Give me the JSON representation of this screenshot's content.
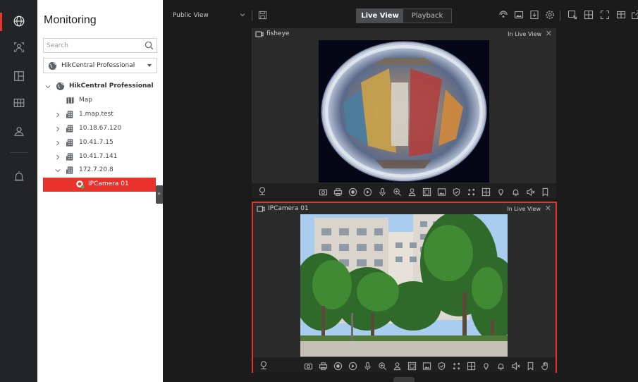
{
  "sidebar": {
    "title": "Monitoring",
    "search_placeholder": "Search",
    "site_selector": "HikCentral Professional",
    "tree": [
      {
        "label": "HikCentral Professional",
        "kind": "root"
      },
      {
        "label": "Map",
        "kind": "map"
      },
      {
        "label": "1.map.test",
        "kind": "area"
      },
      {
        "label": "10.18.67.120",
        "kind": "area"
      },
      {
        "label": "10.41.7.15",
        "kind": "area"
      },
      {
        "label": "10.41.7.141",
        "kind": "area"
      },
      {
        "label": "172.7.20.8",
        "kind": "area"
      },
      {
        "label": "IPCamera 01",
        "kind": "camera",
        "selected": true
      }
    ]
  },
  "rail": {
    "items": [
      "globe-icon",
      "person-icon",
      "layout-icon",
      "grid-icon",
      "user-icon",
      "alarm-icon"
    ],
    "active": "globe-icon"
  },
  "topbar": {
    "view_name": "Public View",
    "tabs": {
      "live": "Live View",
      "playback": "Playback"
    },
    "icons": [
      "antenna-icon",
      "image-icon",
      "export-icon",
      "settings-icon",
      "snapshot-icon",
      "grid-layout-icon",
      "fullscreen-icon",
      "custom-layout-icon",
      "popout-icon"
    ]
  },
  "windows": [
    {
      "name": "fisheye",
      "status": "In Live View",
      "selected": false
    },
    {
      "name": "IPCamera 01",
      "status": "In Live View",
      "selected": true
    }
  ],
  "colors": {
    "accent": "#e8322b",
    "bg": "#1b1b1b",
    "rail": "#222426",
    "panel": "#ffffff"
  }
}
